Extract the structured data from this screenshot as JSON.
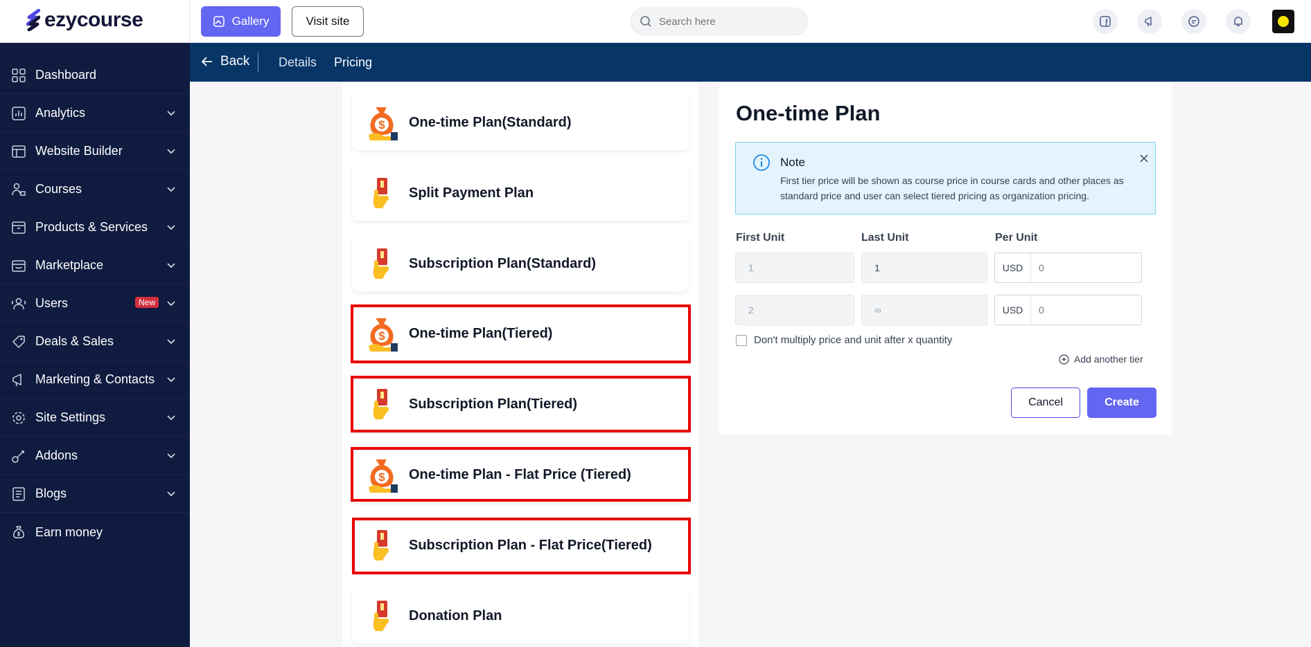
{
  "brand": {
    "name": "ezycourse"
  },
  "topbar": {
    "gallery_label": "Gallery",
    "visit_label": "Visit site",
    "search_placeholder": "Search here",
    "icons": [
      "facebook-icon",
      "megaphone-icon",
      "chat-icon",
      "bell-icon"
    ]
  },
  "sidebar": {
    "items": [
      {
        "label": "Dashboard",
        "icon": "dashboard-icon",
        "chevron": false
      },
      {
        "label": "Analytics",
        "icon": "analytics-icon",
        "chevron": true
      },
      {
        "label": "Website Builder",
        "icon": "website-builder-icon",
        "chevron": true
      },
      {
        "label": "Courses",
        "icon": "courses-icon",
        "chevron": true
      },
      {
        "label": "Products & Services",
        "icon": "products-icon",
        "chevron": true
      },
      {
        "label": "Marketplace",
        "icon": "marketplace-icon",
        "chevron": true
      },
      {
        "label": "Users",
        "icon": "users-icon",
        "chevron": true,
        "badge": "New"
      },
      {
        "label": "Deals & Sales",
        "icon": "deals-icon",
        "chevron": true
      },
      {
        "label": "Marketing & Contacts",
        "icon": "marketing-icon",
        "chevron": true
      },
      {
        "label": "Site Settings",
        "icon": "settings-icon",
        "chevron": true
      },
      {
        "label": "Addons",
        "icon": "addons-icon",
        "chevron": true
      },
      {
        "label": "Blogs",
        "icon": "blogs-icon",
        "chevron": true
      },
      {
        "label": "Earn money",
        "icon": "money-bag-icon",
        "chevron": false
      }
    ]
  },
  "subheader": {
    "back_label": "Back",
    "tabs": [
      "Details",
      "Pricing"
    ],
    "active_tab": "Pricing"
  },
  "plans": [
    {
      "label": "One-time Plan(Standard)",
      "icon": "money-bag-icon",
      "highlighted": false
    },
    {
      "label": "Split Payment Plan",
      "icon": "card-hand-icon",
      "highlighted": false
    },
    {
      "label": "Subscription Plan(Standard)",
      "icon": "card-hand-icon",
      "highlighted": false
    },
    {
      "label": "One-time Plan(Tiered)",
      "icon": "money-bag-icon",
      "highlighted": true
    },
    {
      "label": "Subscription Plan(Tiered)",
      "icon": "card-hand-icon",
      "highlighted": true
    },
    {
      "label": "One-time Plan - Flat Price (Tiered)",
      "icon": "money-bag-icon",
      "highlighted": true
    },
    {
      "label": "Subscription Plan - Flat Price(Tiered)",
      "icon": "card-hand-icon",
      "highlighted": true
    },
    {
      "label": "Donation Plan",
      "icon": "card-hand-icon",
      "highlighted": false
    }
  ],
  "form": {
    "title": "One-time Plan",
    "note_title": "Note",
    "note_body": "First tier price will be shown as course price in course cards and other places as standard price and user can select tiered pricing as organization pricing.",
    "columns": {
      "first_unit": "First Unit",
      "last_unit": "Last Unit",
      "per_unit": "Per Unit"
    },
    "tiers": [
      {
        "first": "1",
        "last": "1",
        "currency": "USD",
        "price_placeholder": "0"
      },
      {
        "first": "2",
        "last": "∞",
        "currency": "USD",
        "price_placeholder": "0"
      }
    ],
    "checkbox_label": "Don't multiply price and unit after x quantity",
    "checkbox_checked": false,
    "add_tier_label": "Add another tier",
    "cancel_label": "Cancel",
    "create_label": "Create"
  },
  "colors": {
    "sidebar_bg": "#0f1b3f",
    "subheader_bg": "#063566",
    "accent": "#6366f1",
    "highlight": "#e90000",
    "note_bg": "#e3f4fd"
  }
}
